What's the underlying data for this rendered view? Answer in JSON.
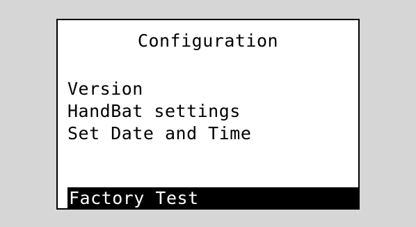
{
  "screen": {
    "title": "Configuration",
    "menu": {
      "items": [
        "Version",
        "HandBat settings",
        "Set Date and Time"
      ],
      "selected": "Factory Test"
    }
  },
  "colors": {
    "background": "#d6d6d6",
    "screen": "#ffffff",
    "text": "#000000",
    "highlight": "#000000",
    "highlight_text": "#ffffff"
  }
}
